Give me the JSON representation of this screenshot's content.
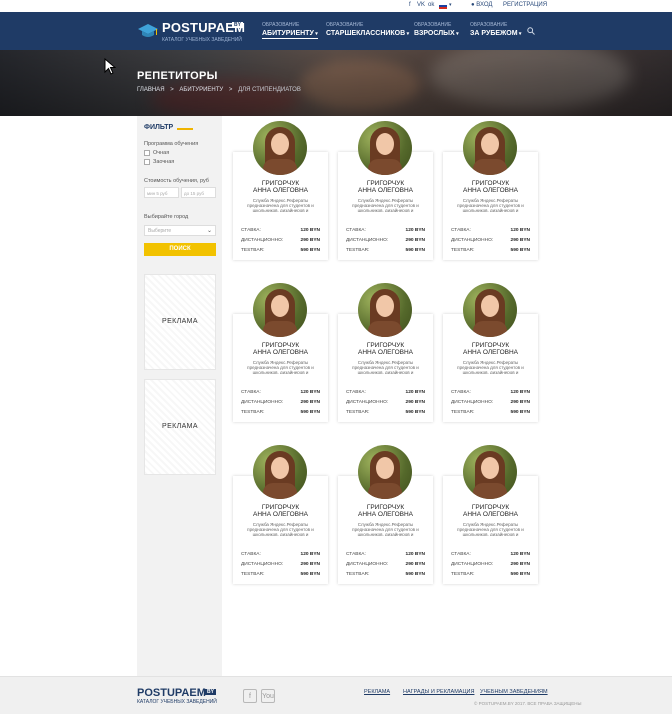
{
  "topbar": {
    "social": [
      "f",
      "VK",
      "ok"
    ],
    "lang": "RU",
    "login": "ВХОД",
    "register": "РЕГИСТРАЦИЯ"
  },
  "header": {
    "brand": "POSTUPAEM",
    "brand_suffix": "BY",
    "tagline": "КАТАЛОГ УЧЕБНЫХ ЗАВЕДЕНИЙ",
    "nav": [
      {
        "small": "ОБРАЗОВАНИЕ",
        "big": "АБИТУРИЕНТУ"
      },
      {
        "small": "ОБРАЗОВАНИЕ",
        "big": "СТАРШЕКЛАССНИКОВ"
      },
      {
        "small": "ОБРАЗОВАНИЕ",
        "big": "ВЗРОСЛЫХ"
      },
      {
        "small": "ОБРАЗОВАНИЕ",
        "big": "ЗА РУБЕЖОМ"
      }
    ]
  },
  "hero": {
    "title": "РЕПЕТИТОРЫ",
    "breadcrumbs": [
      "ГЛАВНАЯ",
      ">",
      "АБИТУРИЕНТУ",
      ">",
      "ДЛЯ СТИПЕНДИАТОВ"
    ]
  },
  "filter": {
    "title": "ФИЛЬТР",
    "program_label": "Программа обучения",
    "options": [
      "Очная",
      "Заочная"
    ],
    "price_label": "Стоимость обучения, руб",
    "price_from": "мин 5 руб",
    "price_to": "до 15 руб",
    "city_label": "Выбирайте город",
    "city_placeholder": "Выберите",
    "search_button": "ПОИСК",
    "ad1": "РЕКЛАМА",
    "ad2": "РЕКЛАМА"
  },
  "tutors": [
    {
      "first": "ГРИГОРЧУК",
      "last": "АННА ОЛЕГОВНА",
      "desc": "Служба Яндекс.Рефераты предназначена для студентов и школьников, дизайнеров и",
      "rows": [
        [
          "СТАВКА:",
          "120 BYN"
        ],
        [
          "ДИСТАНЦИОННО:",
          "290 BYN"
        ],
        [
          "TESTBAR:",
          "590 BYN"
        ]
      ]
    },
    {
      "first": "ГРИГОРЧУК",
      "last": "АННА ОЛЕГОВНА",
      "desc": "Служба Яндекс.Рефераты предназначена для студентов и школьников, дизайнеров и",
      "rows": [
        [
          "СТАВКА:",
          "120 BYN"
        ],
        [
          "ДИСТАНЦИОННО:",
          "290 BYN"
        ],
        [
          "TESTBAR:",
          "590 BYN"
        ]
      ]
    },
    {
      "first": "ГРИГОРЧУК",
      "last": "АННА ОЛЕГОВНА",
      "desc": "Служба Яндекс.Рефераты предназначена для студентов и школьников, дизайнеров и",
      "rows": [
        [
          "СТАВКА:",
          "120 BYN"
        ],
        [
          "ДИСТАНЦИОННО:",
          "290 BYN"
        ],
        [
          "TESTBAR:",
          "590 BYN"
        ]
      ]
    },
    {
      "first": "ГРИГОРЧУК",
      "last": "АННА ОЛЕГОВНА",
      "desc": "Служба Яндекс.Рефераты предназначена для студентов и школьников, дизайнеров и",
      "rows": [
        [
          "СТАВКА:",
          "120 BYN"
        ],
        [
          "ДИСТАНЦИОННО:",
          "290 BYN"
        ],
        [
          "TESTBAR:",
          "590 BYN"
        ]
      ]
    },
    {
      "first": "ГРИГОРЧУК",
      "last": "АННА ОЛЕГОВНА",
      "desc": "Служба Яндекс.Рефераты предназначена для студентов и школьников, дизайнеров и",
      "rows": [
        [
          "СТАВКА:",
          "120 BYN"
        ],
        [
          "ДИСТАНЦИОННО:",
          "290 BYN"
        ],
        [
          "TESTBAR:",
          "590 BYN"
        ]
      ]
    },
    {
      "first": "ГРИГОРЧУК",
      "last": "АННА ОЛЕГОВНА",
      "desc": "Служба Яндекс.Рефераты предназначена для студентов и школьников, дизайнеров и",
      "rows": [
        [
          "СТАВКА:",
          "120 BYN"
        ],
        [
          "ДИСТАНЦИОННО:",
          "290 BYN"
        ],
        [
          "TESTBAR:",
          "590 BYN"
        ]
      ]
    },
    {
      "first": "ГРИГОРЧУК",
      "last": "АННА ОЛЕГОВНА",
      "desc": "Служба Яндекс.Рефераты предназначена для студентов и школьников, дизайнеров и",
      "rows": [
        [
          "СТАВКА:",
          "120 BYN"
        ],
        [
          "ДИСТАНЦИОННО:",
          "290 BYN"
        ],
        [
          "TESTBAR:",
          "590 BYN"
        ]
      ]
    },
    {
      "first": "ГРИГОРЧУК",
      "last": "АННА ОЛЕГОВНА",
      "desc": "Служба Яндекс.Рефераты предназначена для студентов и школьников, дизайнеров и",
      "rows": [
        [
          "СТАВКА:",
          "120 BYN"
        ],
        [
          "ДИСТАНЦИОННО:",
          "290 BYN"
        ],
        [
          "TESTBAR:",
          "590 BYN"
        ]
      ]
    },
    {
      "first": "ГРИГОРЧУК",
      "last": "АННА ОЛЕГОВНА",
      "desc": "Служба Яндекс.Рефераты предназначена для студентов и школьников, дизайнеров и",
      "rows": [
        [
          "СТАВКА:",
          "120 BYN"
        ],
        [
          "ДИСТАНЦИОННО:",
          "290 BYN"
        ],
        [
          "TESTBAR:",
          "590 BYN"
        ]
      ]
    }
  ],
  "footer": {
    "brand": "POSTUPAEM",
    "brand_suffix": "BY",
    "tagline": "КАТАЛОГ УЧЕБНЫХ ЗАВЕДЕНИЙ",
    "social": [
      "f",
      "You"
    ],
    "links": [
      "РЕКЛАМА",
      "НАГРАДЫ И РЕКЛАМАЦИЯ",
      "УЧЕБНЫМ ЗАВЕДЕНИЯМ"
    ],
    "copyright": "© POSTUPAEM.BY 2017. ВСЕ ПРАВА ЗАЩИЩЕНЫ"
  },
  "colors": {
    "header_bg": "#1f3b66",
    "accent": "#f2c200"
  }
}
